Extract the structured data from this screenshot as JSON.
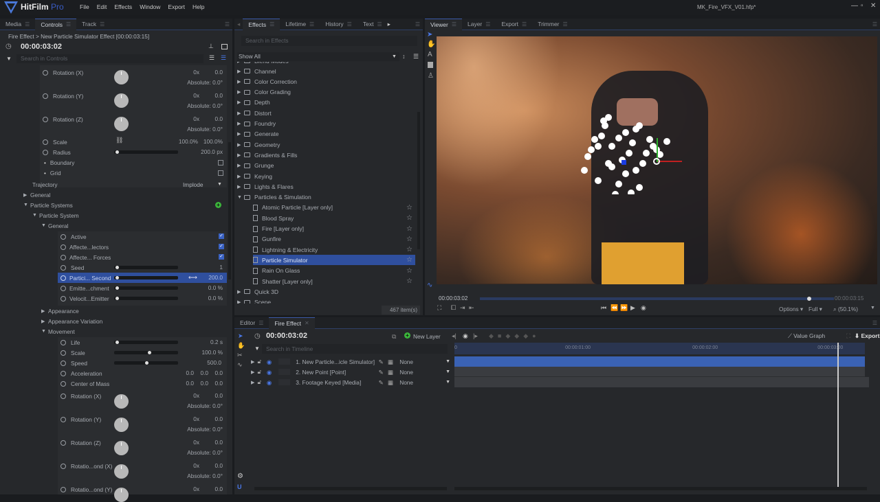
{
  "app": {
    "name": "HitFilm",
    "edition": "Pro",
    "filename": "MK_Fire_VFX_V01.hfp*",
    "menu": [
      "File",
      "Edit",
      "Effects",
      "Window",
      "Export",
      "Help"
    ]
  },
  "left_panel": {
    "tabs": [
      "Media",
      "Controls",
      "Track"
    ],
    "active_tab": "Controls",
    "breadcrumb": "Fire Effect > New Particle Simulator Effect [00:00:03:15]",
    "timecode": "00:00:03:02",
    "search_placeholder": "Search in Controls",
    "rows": [
      {
        "type": "dial",
        "label": "Rotation (X)",
        "turns": "0x",
        "value": "0.0",
        "absolute": "Absolute: 0.0°"
      },
      {
        "type": "dial",
        "label": "Rotation (Y)",
        "turns": "0x",
        "value": "0.0",
        "absolute": "Absolute: 0.0°"
      },
      {
        "type": "dial",
        "label": "Rotation (Z)",
        "turns": "0x",
        "value": "0.0",
        "absolute": "Absolute: 0.0°"
      },
      {
        "type": "scale",
        "label": "Scale",
        "v1": "100.0%",
        "v2": "100.0%"
      },
      {
        "type": "slider",
        "label": "Radius",
        "value": "200.0 px",
        "fraction": 0.0
      },
      {
        "type": "check",
        "label": "Boundary",
        "checked": false
      },
      {
        "type": "check",
        "label": "Grid",
        "checked": false
      }
    ],
    "trajectory": {
      "label": "Trajectory",
      "value": "Implode"
    },
    "tree": [
      {
        "label": "General",
        "expanded": false
      },
      {
        "label": "Particle Systems",
        "expanded": true
      },
      {
        "label": "Particle System",
        "expanded": true
      },
      {
        "label": "General",
        "expanded": true
      }
    ],
    "general_rows": [
      {
        "type": "check",
        "label": "Active",
        "checked": true
      },
      {
        "type": "check",
        "label": "Affecte...lectors",
        "checked": true
      },
      {
        "type": "check",
        "label": "Affecte... Forces",
        "checked": true
      },
      {
        "type": "slider",
        "label": "Seed",
        "value": "1",
        "fraction": 0.0
      },
      {
        "type": "slider",
        "label": "Partici... Second",
        "value": "200.0",
        "fraction": 0.0,
        "selected": true
      },
      {
        "type": "slider",
        "label": "Emitte...chment",
        "value": "0.0 %",
        "fraction": 0.0
      },
      {
        "type": "slider",
        "label": "Velocit...Emitter",
        "value": "0.0 %",
        "fraction": 0.0
      }
    ],
    "subgroups": [
      "Appearance",
      "Appearance Variation",
      "Movement"
    ],
    "movement_rows": [
      {
        "type": "slider",
        "label": "Life",
        "value": "0.2 s",
        "fraction": 0.02
      },
      {
        "type": "slider",
        "label": "Scale",
        "value": "100.0 %",
        "fraction": 0.55
      },
      {
        "type": "slider",
        "label": "Speed",
        "value": "500.0",
        "fraction": 0.5
      },
      {
        "type": "triple",
        "label": "Acceleration",
        "values": [
          "0.0",
          "0.0",
          "0.0"
        ]
      },
      {
        "type": "triple",
        "label": "Center of Mass",
        "values": [
          "0.0",
          "0.0",
          "0.0"
        ]
      },
      {
        "type": "dial",
        "label": "Rotation (X)",
        "turns": "0x",
        "value": "0.0",
        "absolute": "Absolute: 0.0°"
      },
      {
        "type": "dial",
        "label": "Rotation (Y)",
        "turns": "0x",
        "value": "0.0",
        "absolute": "Absolute: 0.0°"
      },
      {
        "type": "dial",
        "label": "Rotation (Z)",
        "turns": "0x",
        "value": "0.0",
        "absolute": "Absolute: 0.0°"
      },
      {
        "type": "dial",
        "label": "Rotatio...ond (X)",
        "turns": "0x",
        "value": "0.0",
        "absolute": "Absolute: 0.0°"
      },
      {
        "type": "dial",
        "label": "Rotatio...ond (Y)",
        "turns": "0x",
        "value": "0.0",
        "absolute": ""
      }
    ]
  },
  "effects_panel": {
    "tabs": [
      "Effects",
      "Lifetime",
      "History",
      "Text"
    ],
    "active_tab": "Effects",
    "search_placeholder": "Search in Effects",
    "filter": "Show All",
    "folders_before": [
      "Channel",
      "Color Correction",
      "Color Grading",
      "Depth",
      "Distort",
      "Foundry",
      "Generate",
      "Geometry",
      "Gradients & Fills",
      "Grunge",
      "Keying",
      "Lights & Flares"
    ],
    "open_folder": "Particles & Simulation",
    "items": [
      "Atomic Particle [Layer only]",
      "Blood Spray",
      "Fire [Layer only]",
      "Gunfire",
      "Lightning & Electricity",
      "Particle Simulator",
      "Rain On Glass",
      "Shatter [Layer only]"
    ],
    "selected_item": "Particle Simulator",
    "folders_after": [
      "Quick 3D",
      "Scene"
    ],
    "count": "467 item(s)"
  },
  "viewer": {
    "tabs": [
      "Viewer",
      "Layer",
      "Export",
      "Trimmer"
    ],
    "active_tab": "Viewer",
    "current_time": "00:00:03:02",
    "end_time": "00:00:03:15",
    "playhead_fraction": 0.93,
    "options": "Options",
    "quality": "Full",
    "zoom": "(50.1%)"
  },
  "editor": {
    "tabs": [
      "Editor",
      "Fire Effect"
    ],
    "active_tab": "Fire Effect",
    "timecode": "00:00:03:02",
    "new_layer": "New Layer",
    "search_placeholder": "Search in Timeline",
    "value_graph": "Value Graph",
    "export": "Export",
    "ruler": [
      "0",
      "00:00:01:00",
      "00:00:02:00",
      "00:00:03:00"
    ],
    "layers": [
      {
        "name": "1. New Particle...icle Simulator]",
        "blend": "None"
      },
      {
        "name": "2. New Point [Point]",
        "blend": "None"
      },
      {
        "name": "3. Footage Keyed [Media]",
        "blend": "None"
      }
    ]
  }
}
